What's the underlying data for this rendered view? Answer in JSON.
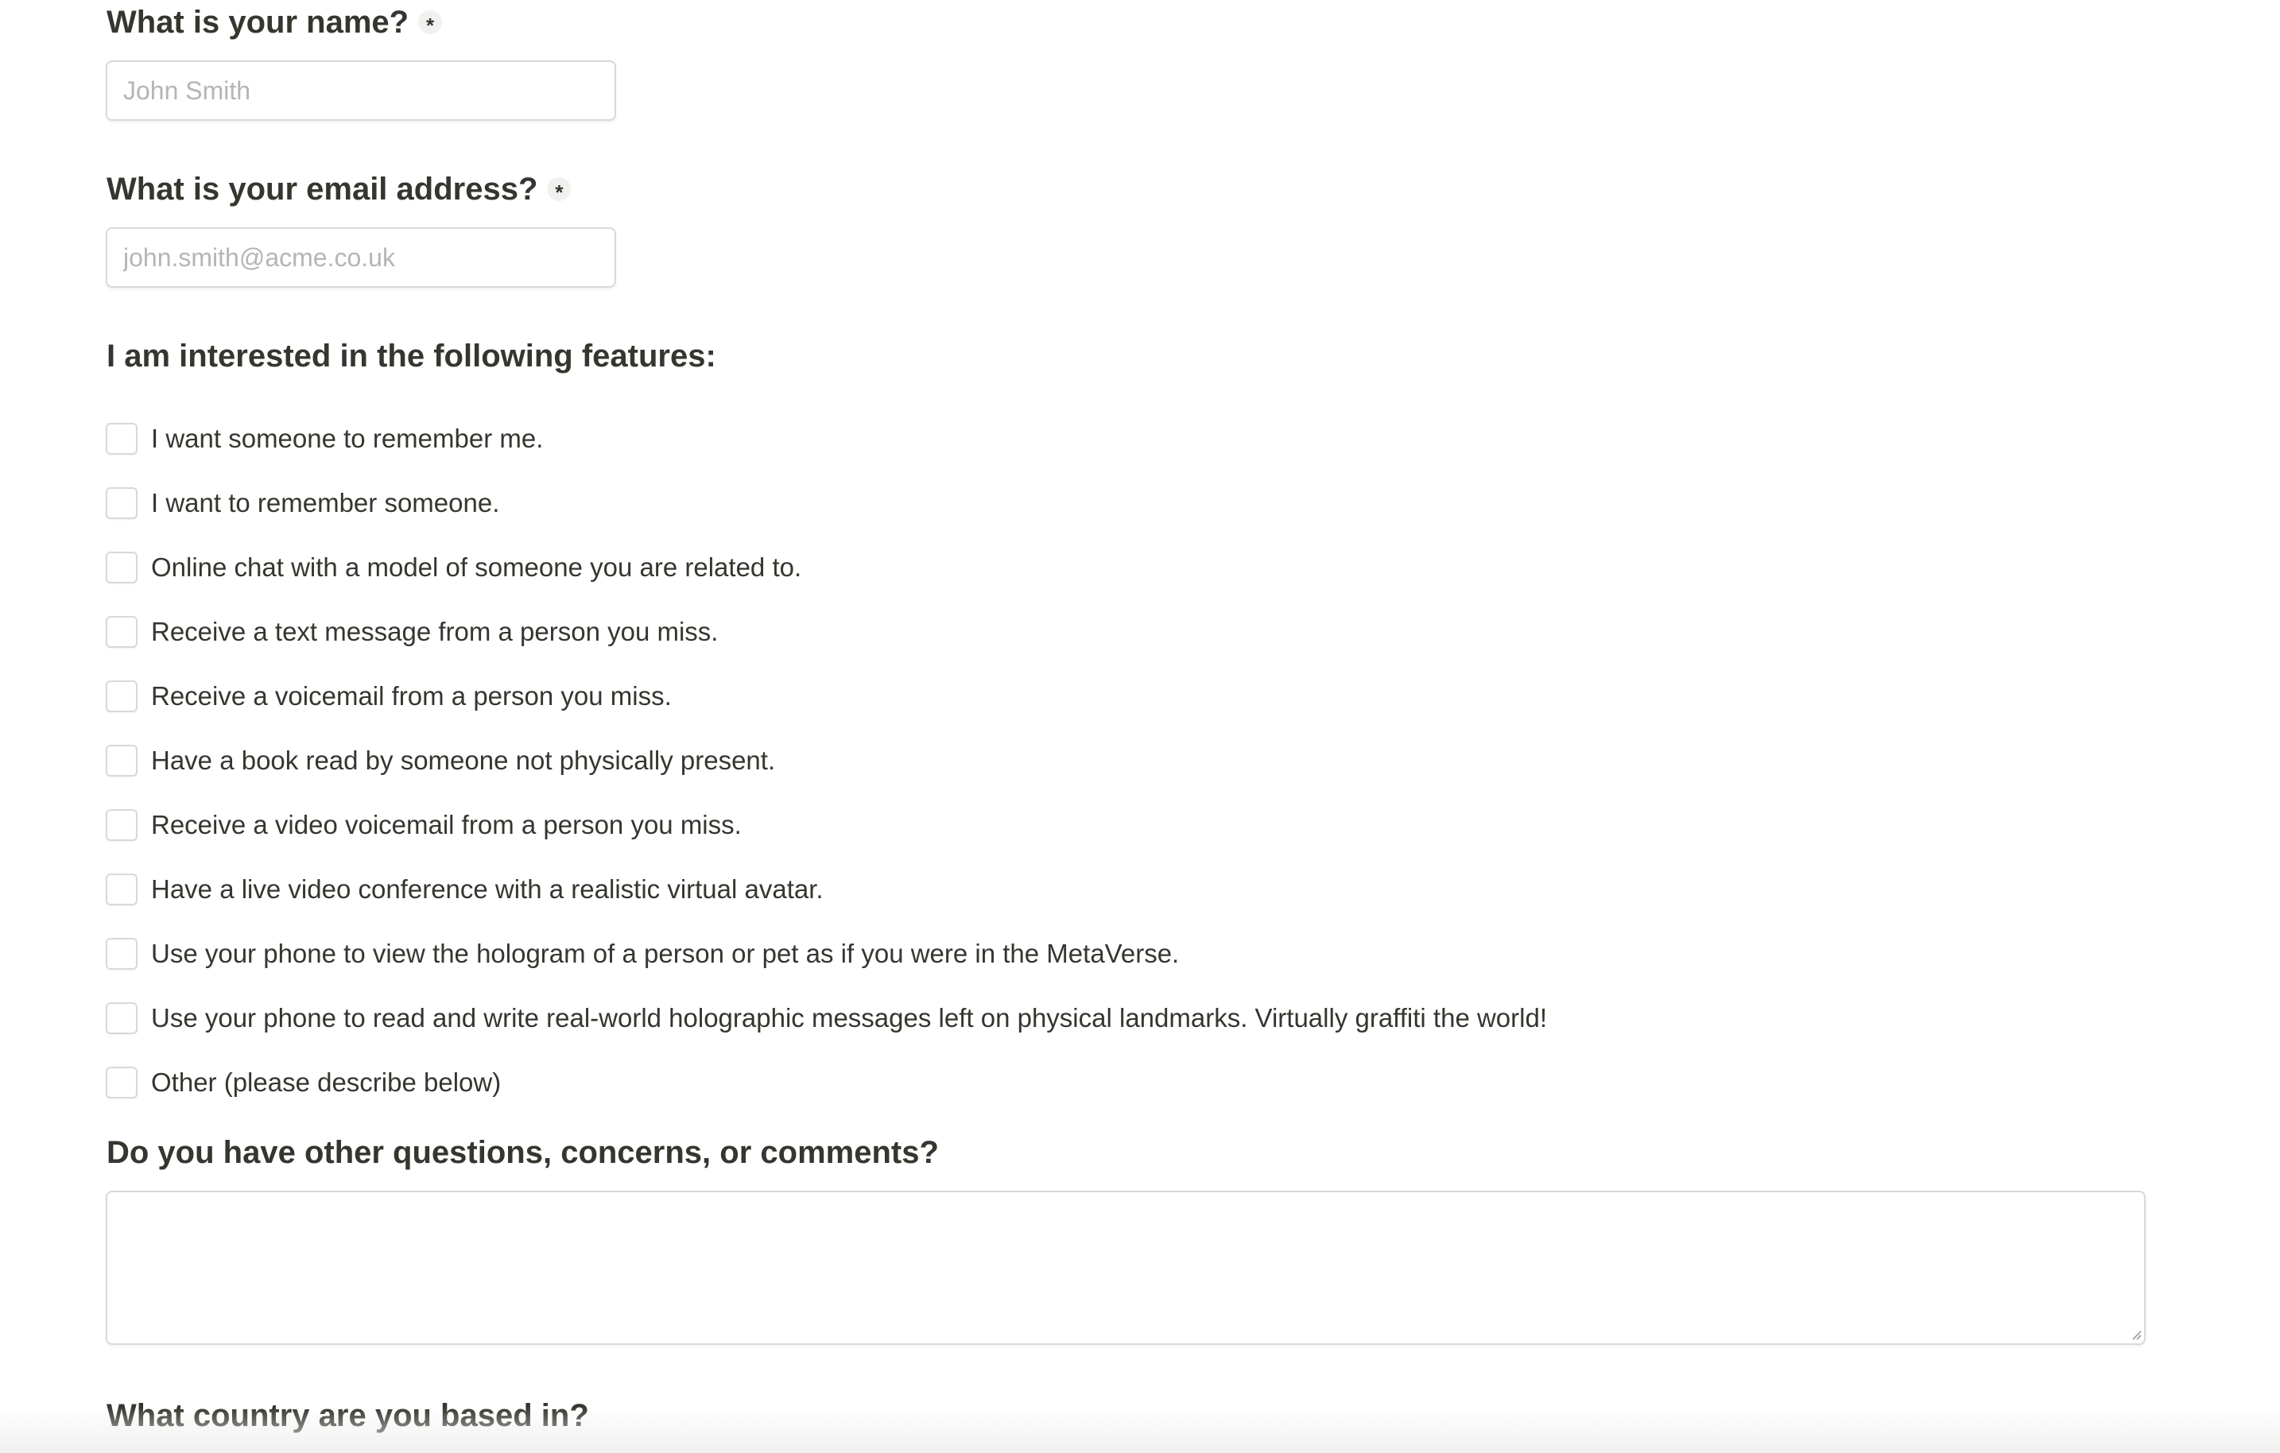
{
  "form": {
    "name_question": {
      "label": "What is your name?",
      "required_marker": "*",
      "placeholder": "John Smith",
      "value": ""
    },
    "email_question": {
      "label": "What is your email address?",
      "required_marker": "*",
      "placeholder": "john.smith@acme.co.uk",
      "value": ""
    },
    "features_question": {
      "label": "I am interested in the following features:",
      "options": [
        {
          "label": "I want someone to remember me.",
          "checked": false
        },
        {
          "label": "I want to remember someone.",
          "checked": false
        },
        {
          "label": "Online chat with a model of someone you are related to.",
          "checked": false
        },
        {
          "label": "Receive a text message from a person you miss.",
          "checked": false
        },
        {
          "label": "Receive a voicemail from a person you miss.",
          "checked": false
        },
        {
          "label": "Have a book read by someone not physically present.",
          "checked": false
        },
        {
          "label": "Receive a video voicemail from a person you miss.",
          "checked": false
        },
        {
          "label": "Have a live video conference with a realistic virtual avatar.",
          "checked": false
        },
        {
          "label": "Use your phone to view the hologram of a person or pet as if you were in the MetaVerse.",
          "checked": false
        },
        {
          "label": "Use your phone to read and write real-world holographic messages left on physical landmarks. Virtually graffiti the world!",
          "checked": false
        },
        {
          "label": "Other (please describe below)",
          "checked": false
        }
      ]
    },
    "comments_question": {
      "label": "Do you have other questions, concerns, or comments?",
      "value": ""
    },
    "country_question": {
      "label": "What country are you based in?"
    }
  },
  "colors": {
    "text": "#37352f",
    "placeholder": "#b6b5b2",
    "border": "#d9d9d6",
    "required_badge": "#f1f1ef"
  }
}
